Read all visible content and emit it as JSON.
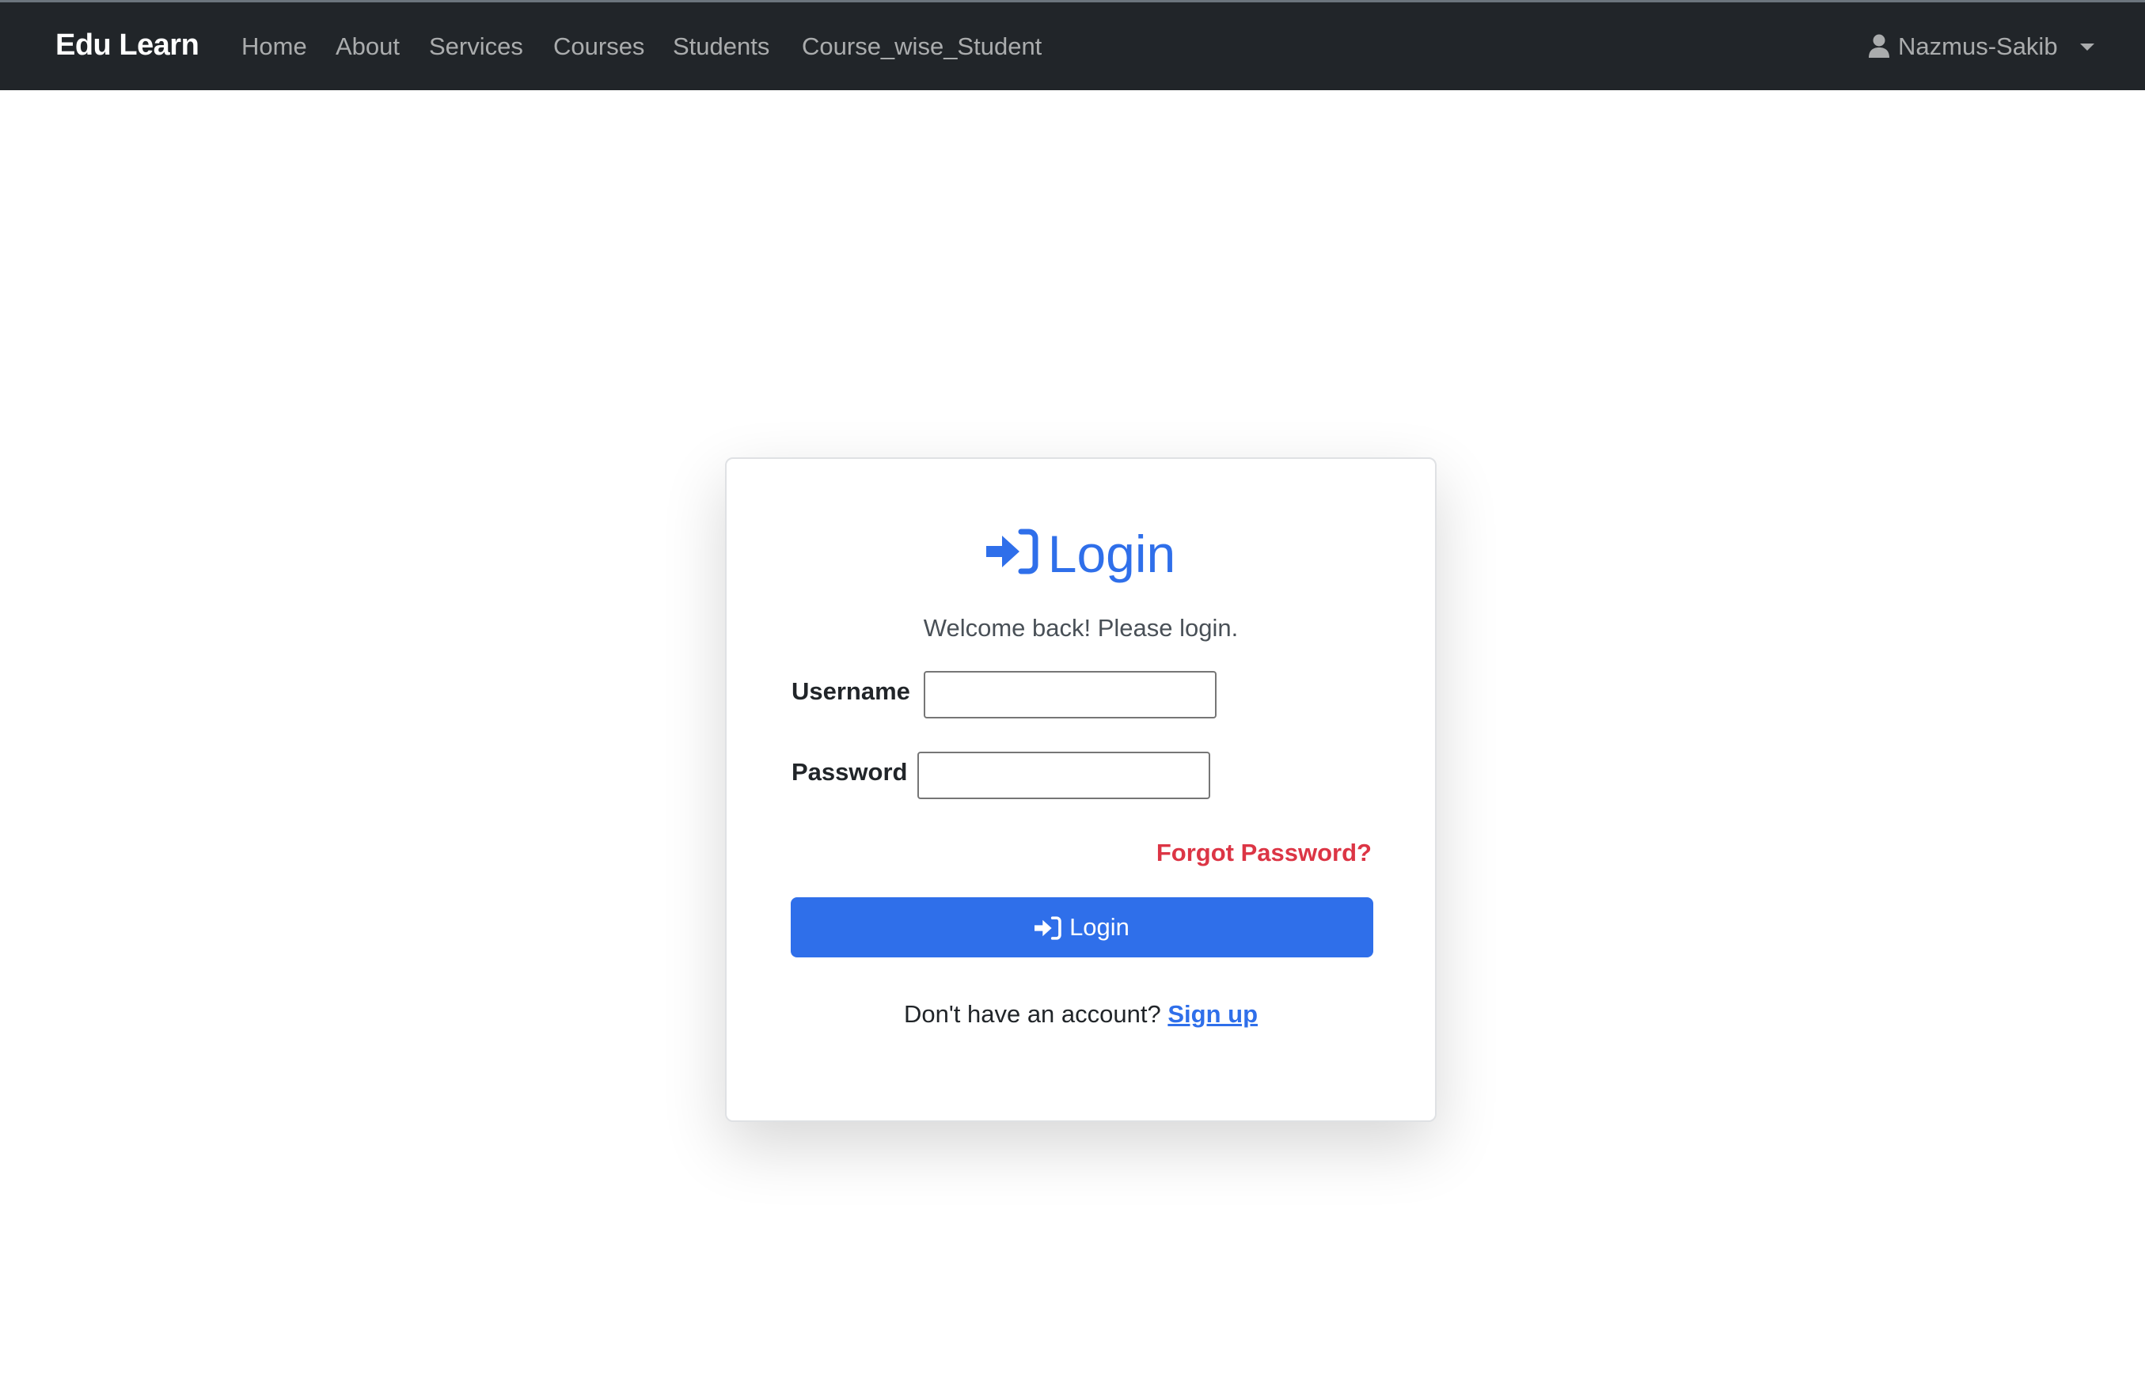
{
  "navbar": {
    "brand": "Edu Learn",
    "links": [
      {
        "label": "Home"
      },
      {
        "label": "About"
      },
      {
        "label": "Services"
      },
      {
        "label": "Courses"
      },
      {
        "label": "Students"
      },
      {
        "label": "Course_wise_Student"
      }
    ],
    "user": {
      "name": "Nazmus-Sakib",
      "icon": "user-icon",
      "dropdown_icon": "caret-down-icon"
    }
  },
  "login_card": {
    "title": "Login",
    "title_icon": "sign-in-icon",
    "welcome_text": "Welcome back! Please login.",
    "username_label": "Username",
    "username_value": "",
    "password_label": "Password",
    "password_value": "",
    "forgot_password": "Forgot Password?",
    "submit_label": "Login",
    "submit_icon": "sign-in-icon",
    "signup_prompt": "Don't have an account?",
    "signup_link": "Sign up"
  },
  "colors": {
    "navbar_bg": "#212529",
    "primary": "#2f6fea",
    "danger": "#dc3545"
  }
}
